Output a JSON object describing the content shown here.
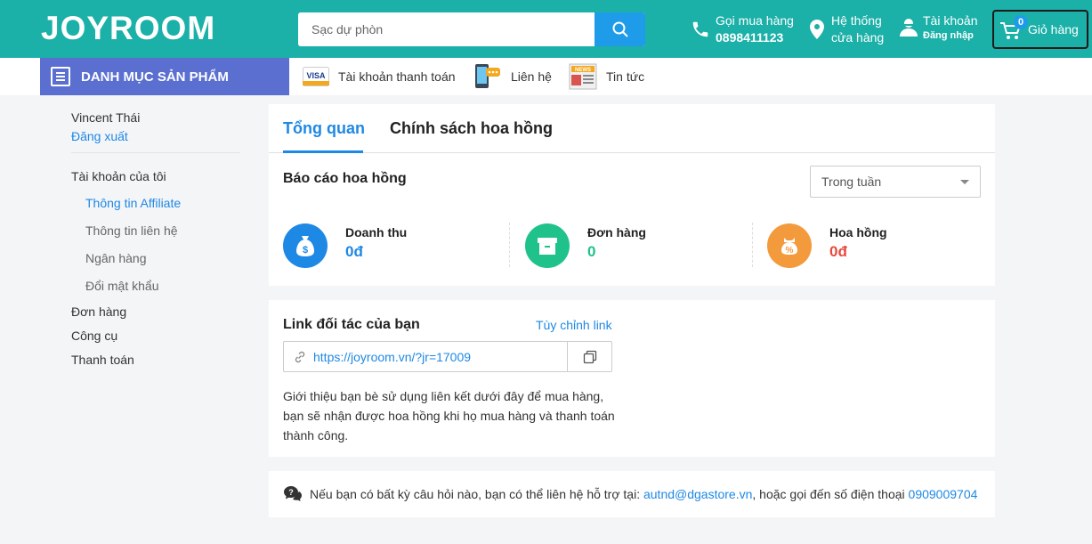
{
  "header": {
    "logo": "JOYROOM",
    "search_placeholder": "Sạc dự phòn",
    "hotline_label": "Gọi mua hàng",
    "hotline_number": "0898411123",
    "stores_line1": "Hệ thống",
    "stores_line2": "cửa hàng",
    "account_label": "Tài khoản",
    "account_sub": "Đăng nhập",
    "cart_label": "Giỏ hàng",
    "cart_count": "0",
    "brand_color": "#1bb0a8"
  },
  "nav": {
    "category_label": "DANH MỤC SẢN PHẨM",
    "links": [
      "Tài khoản thanh toán",
      "Liên hệ",
      "Tin tức"
    ],
    "visa_text": "VISA",
    "news_text": "NEWS"
  },
  "sidebar": {
    "user_name": "Vincent Thái",
    "logout": "Đăng xuất",
    "my_account": "Tài khoản của tôi",
    "sub_items": [
      "Thông tin Affiliate",
      "Thông tin liên hệ",
      "Ngân hàng",
      "Đổi mật khẩu"
    ],
    "orders": "Đơn hàng",
    "tools": "Công cụ",
    "payment": "Thanh toán"
  },
  "tabs": [
    "Tổng quan",
    "Chính sách hoa hồng"
  ],
  "report": {
    "title": "Báo cáo hoa hồng",
    "period": "Trong tuần",
    "stats": [
      {
        "label": "Doanh thu",
        "value": "0đ",
        "color": "#1e88e5"
      },
      {
        "label": "Đơn hàng",
        "value": "0",
        "color": "#1fc28a"
      },
      {
        "label": "Hoa hồng",
        "value": "0đ",
        "color": "#e8483b"
      }
    ]
  },
  "partner_link": {
    "title": "Link đối tác của bạn",
    "customize": "Tùy chỉnh link",
    "url": "https://joyroom.vn/?jr=17009",
    "description": "Giới thiệu bạn bè sử dụng liên kết dưới đây để mua hàng, bạn sẽ nhận được hoa hồng khi họ mua hàng và thanh toán thành công."
  },
  "help": {
    "text_before": "Nếu bạn có bất kỳ câu hỏi nào, bạn có thể liên hệ hỗ trợ tại:",
    "email": "autnd@dgastore.vn",
    "text_middle": ", hoặc gọi đến số điện thoại",
    "phone": "0909009704"
  }
}
